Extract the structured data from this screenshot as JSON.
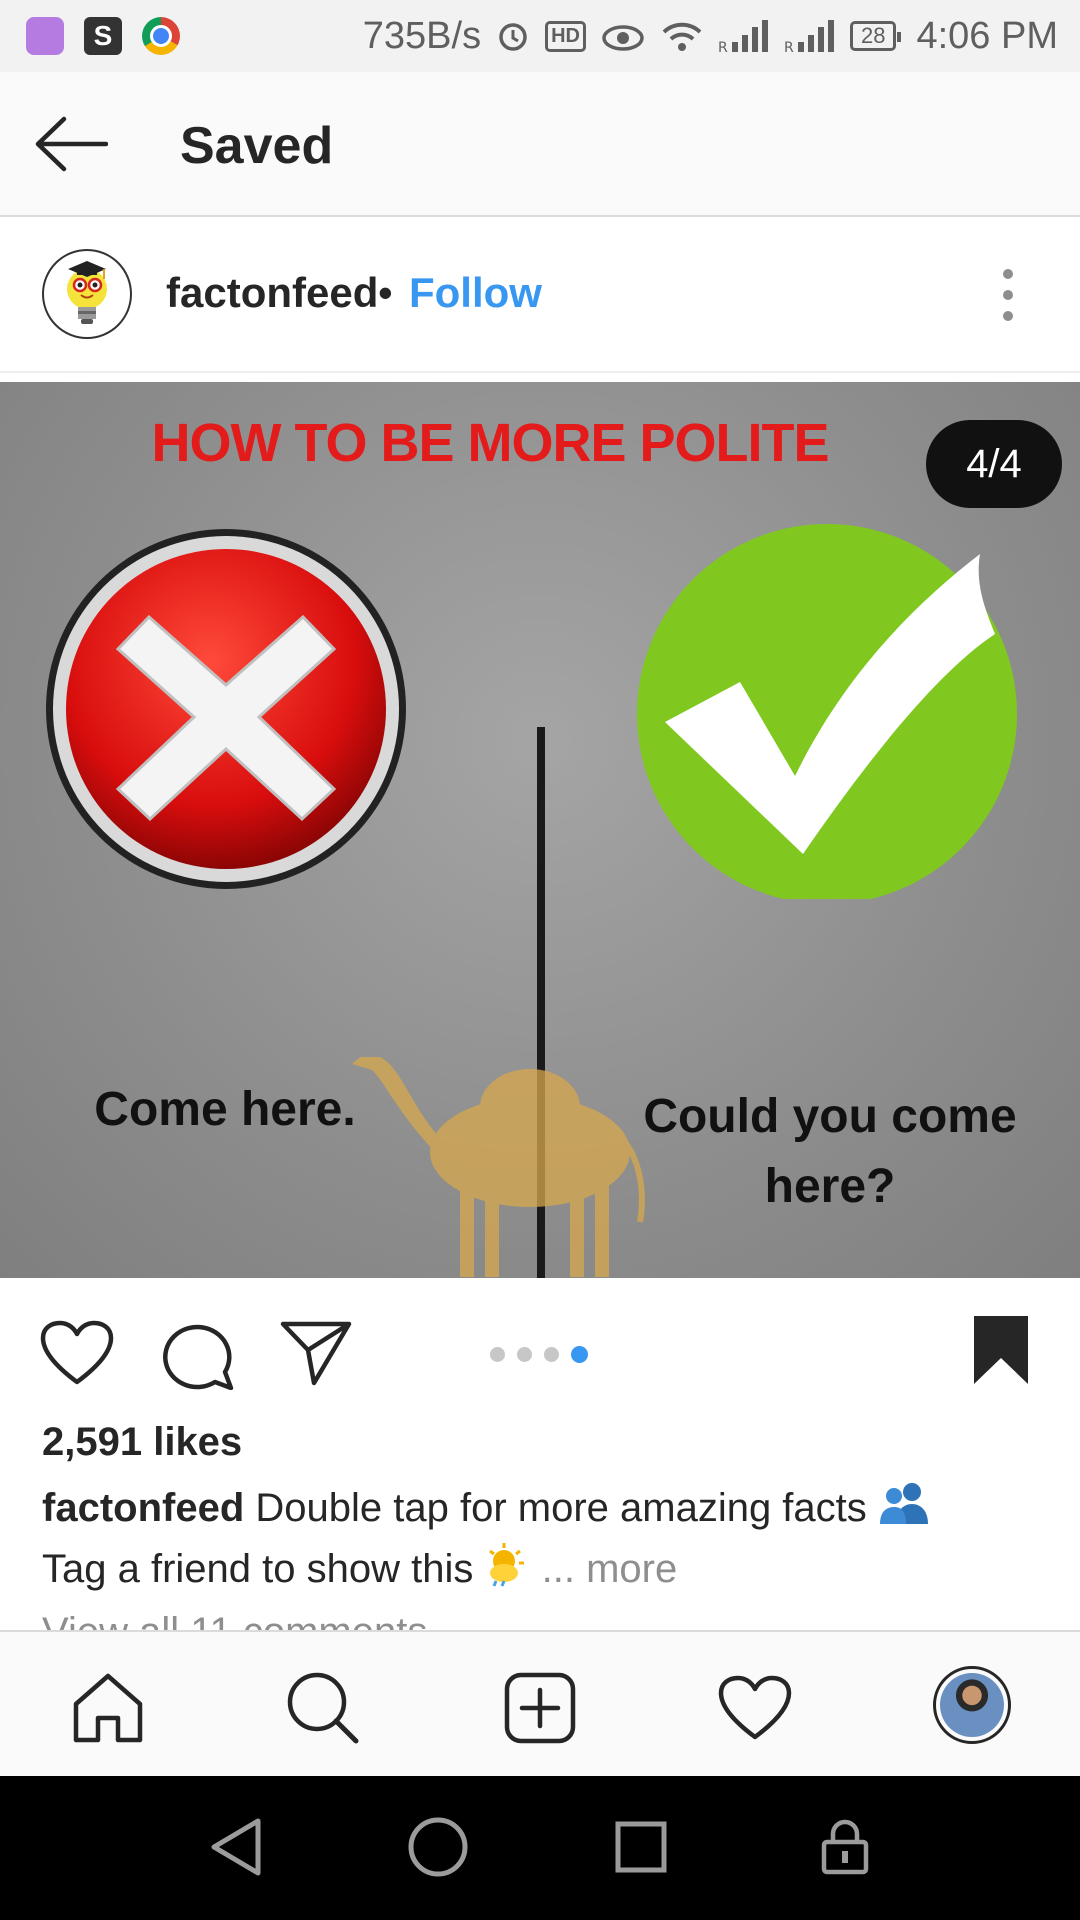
{
  "status_bar": {
    "net_speed": "735B/s",
    "hd_label": "HD",
    "battery": "28",
    "time": "4:06 PM"
  },
  "header": {
    "title": "Saved"
  },
  "post": {
    "username": "factonfeed",
    "separator": "•",
    "follow_label": "Follow",
    "image": {
      "title": "HOW TO BE MORE POLITE",
      "counter": "4/4",
      "left_text": "Come here.",
      "right_text": "Could you come here?"
    },
    "pagination": {
      "total": 4,
      "active": 4
    },
    "likes": "2,591 likes",
    "caption_user": "factonfeed",
    "caption_line1": "Double tap for more amazing facts",
    "caption_line2": "Tag a friend to show this",
    "more_label": "... more",
    "comments_link": "View all 11 comments"
  },
  "icons": {
    "back": "arrow-left-icon",
    "more": "vertical-dots-icon",
    "like": "heart-icon",
    "comment": "comment-bubble-icon",
    "share": "paper-plane-icon",
    "save": "bookmark-filled-icon",
    "nav": [
      "home-icon",
      "search-icon",
      "add-post-icon",
      "activity-heart-icon",
      "profile-avatar"
    ]
  },
  "colors": {
    "accent": "#3897f0",
    "title_red": "#e31b1b",
    "check_green": "#7fc81f",
    "x_red": "#e01010"
  }
}
